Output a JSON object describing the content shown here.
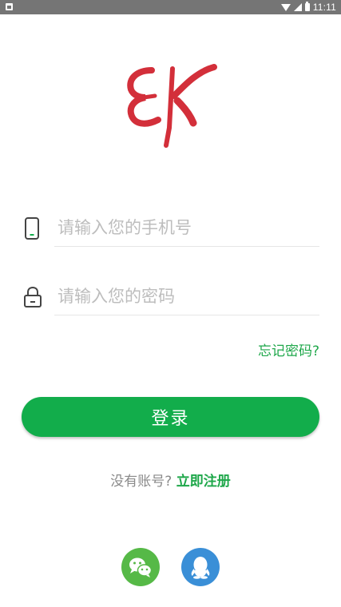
{
  "status_bar": {
    "time": "11:11"
  },
  "logo": {
    "text": "EK",
    "color": "#d32f3a"
  },
  "login_form": {
    "phone_placeholder": "请输入您的手机号",
    "password_placeholder": "请输入您的密码",
    "forgot_password_label": "忘记密码?",
    "login_button_label": "登录"
  },
  "register": {
    "prompt": "没有账号?",
    "link_label": "立即注册"
  },
  "social_login": {
    "wechat_icon": "wechat-icon",
    "qq_icon": "qq-icon"
  },
  "colors": {
    "accent": "#12ad4b",
    "link": "#1ea74a",
    "wechat": "#56b947",
    "qq": "#3a8fd7"
  }
}
